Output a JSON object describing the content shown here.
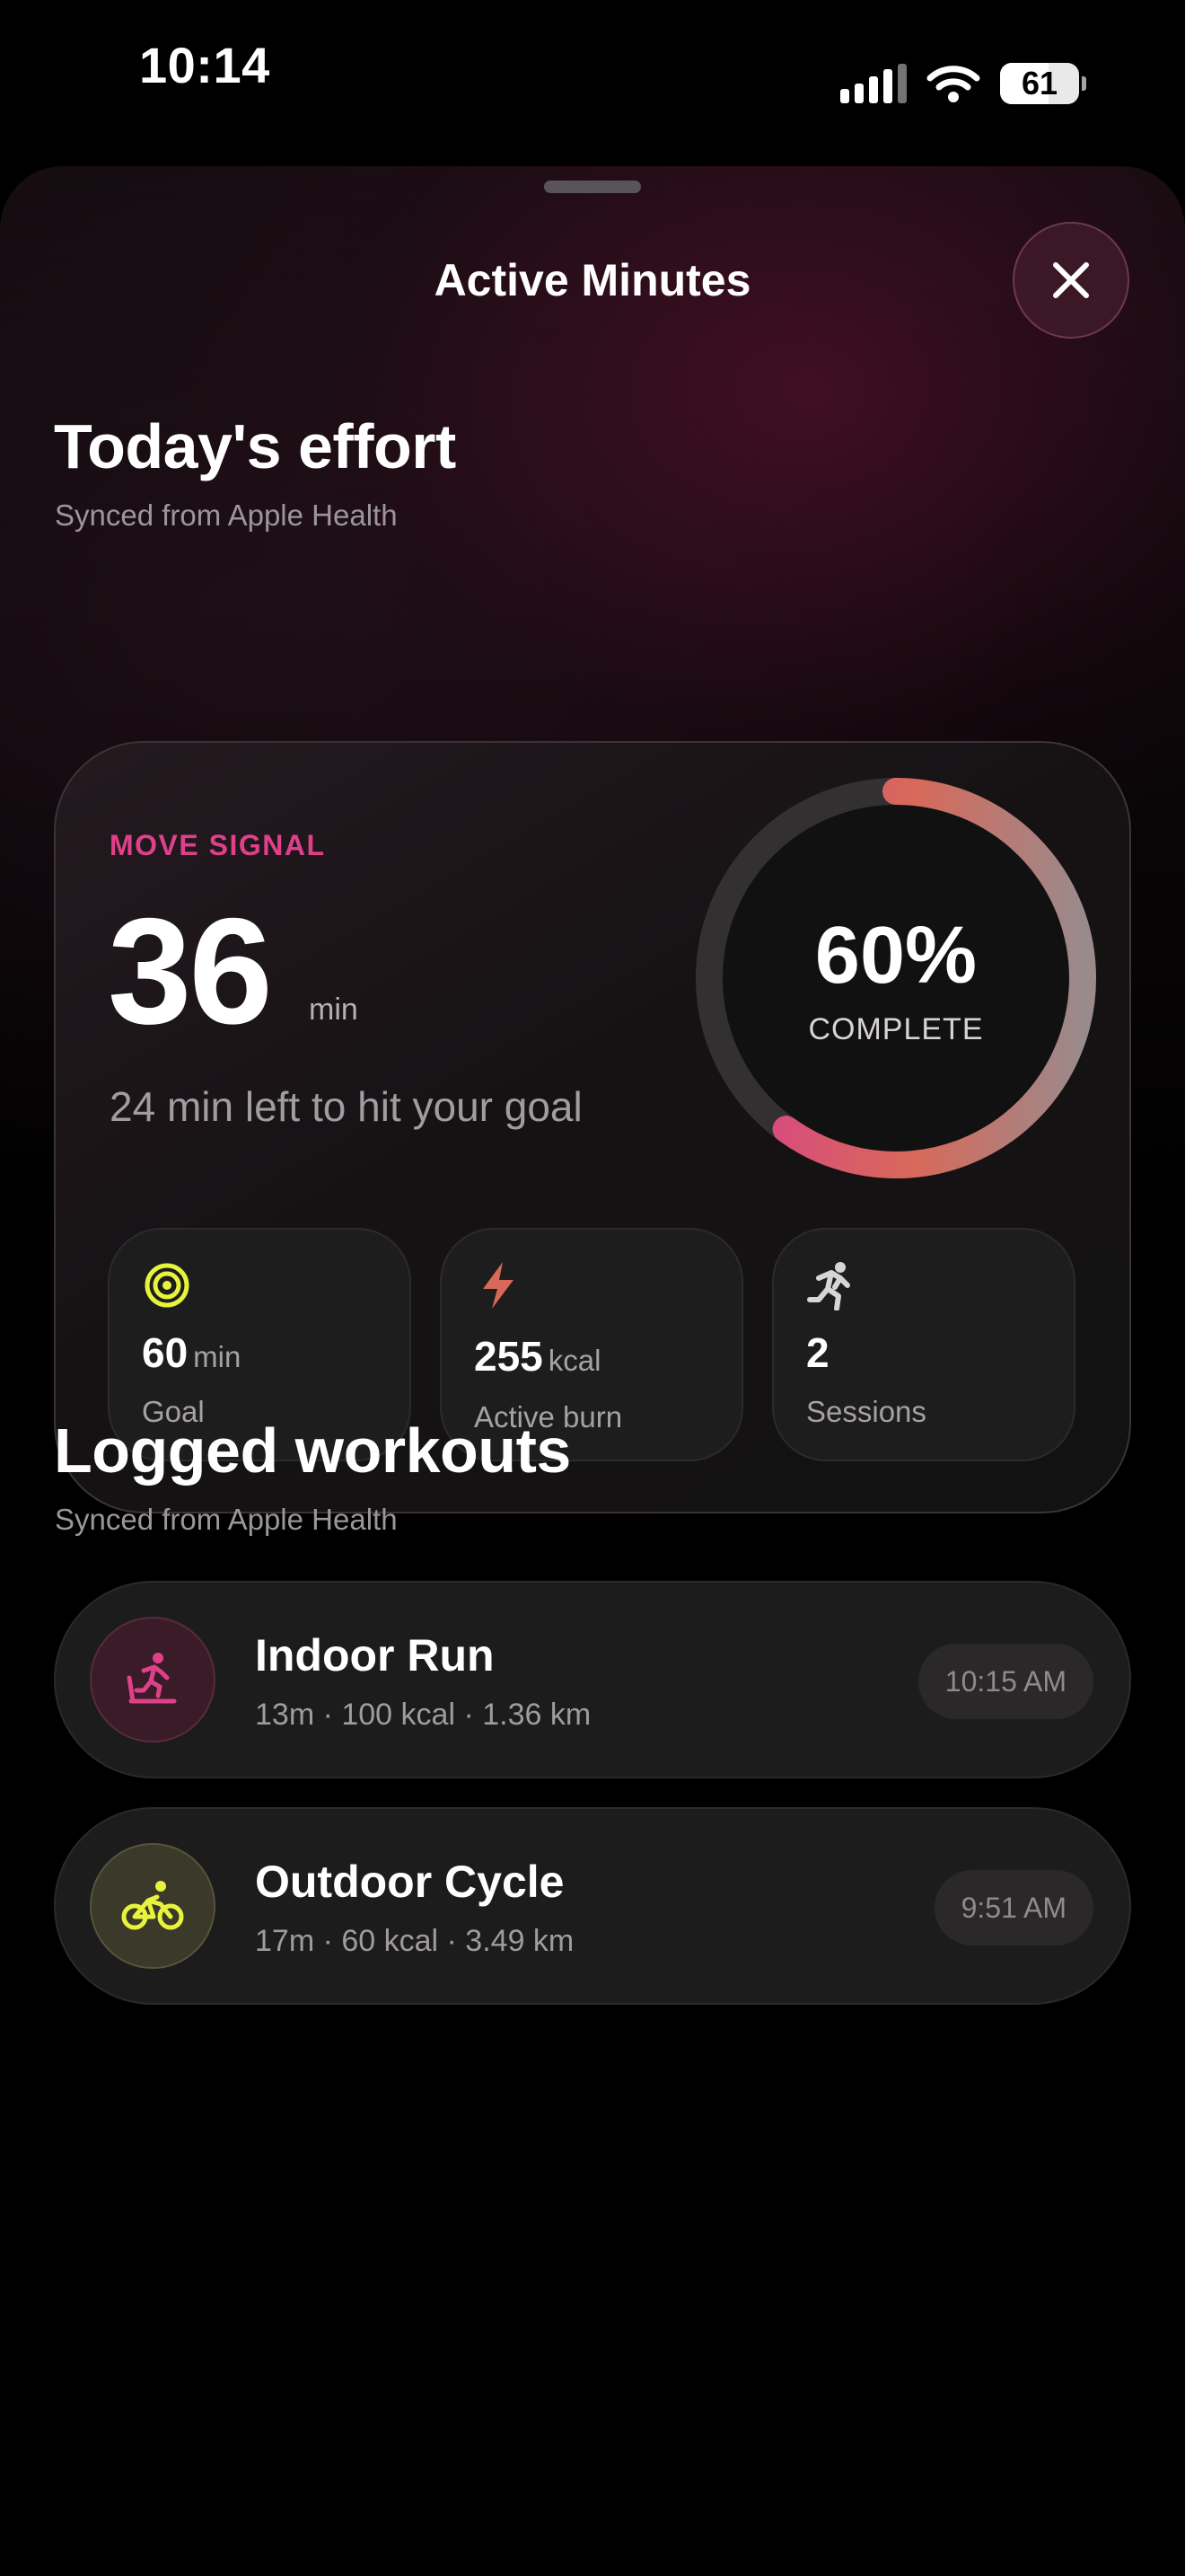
{
  "status_bar": {
    "time": "10:14",
    "battery": "61",
    "battery_level_percent": 61
  },
  "sheet": {
    "title": "Active Minutes"
  },
  "effort": {
    "section_title": "Today's effort",
    "section_subtitle": "Synced from Apple Health",
    "label": "MOVE SIGNAL",
    "minutes": "36",
    "minutes_unit": "min",
    "remaining_text": "24 min left to hit your goal",
    "progress_percent": 60,
    "ring_value": "60%",
    "ring_label": "COMPLETE",
    "stats": [
      {
        "value": "60",
        "unit": "min",
        "label": "Goal",
        "icon": "target-icon",
        "color": "#e8f43c"
      },
      {
        "value": "255",
        "unit": "kcal",
        "label": "Active burn",
        "icon": "lightning-icon",
        "color": "#d8695a"
      },
      {
        "value": "2",
        "unit": "",
        "label": "Sessions",
        "icon": "running-figure-icon",
        "color": "#d6d6d6"
      }
    ]
  },
  "workouts": {
    "section_title": "Logged workouts",
    "section_subtitle": "Synced from Apple Health",
    "items": [
      {
        "name": "Indoor Run",
        "meta": "13m · 100 kcal · 1.36 km",
        "time": "10:15 AM",
        "icon": "treadmill-icon",
        "color": "#e0408a"
      },
      {
        "name": "Outdoor Cycle",
        "meta": "17m · 60 kcal · 3.49 km",
        "time": "9:51 AM",
        "icon": "cycling-icon",
        "color": "#e8f43c"
      }
    ]
  },
  "colors": {
    "accent_pink": "#e0408a",
    "accent_coral": "#d8695a",
    "accent_yellow": "#e8f43c"
  }
}
